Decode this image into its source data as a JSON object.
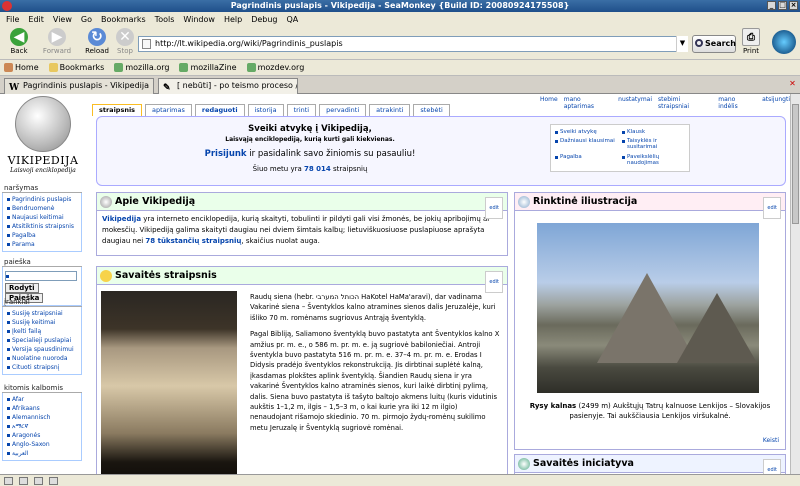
{
  "window": {
    "title": "Pagrindinis puslapis - Vikipedija - SeaMonkey {Build ID: 20080924175508}"
  },
  "menu": [
    "File",
    "Edit",
    "View",
    "Go",
    "Bookmarks",
    "Tools",
    "Window",
    "Help",
    "Debug",
    "QA"
  ],
  "nav": {
    "back": "Back",
    "forward": "Forward",
    "reload": "Reload",
    "stop": "Stop",
    "print": "Print",
    "search": "Search"
  },
  "url": "http://lt.wikipedia.org/wiki/Pagrindinis_puslapis",
  "bookmarks": [
    "Home",
    "Bookmarks",
    "mozilla.org",
    "mozillaZine",
    "mozdev.org"
  ],
  "tabs": [
    {
      "label": "Pagrindinis puslapis - Vikipedija",
      "fav": "W"
    },
    {
      "label": "[ nebūti] - po teismo proceso / K...",
      "fav": "✎"
    }
  ],
  "wiki": {
    "logo_name": "VIKIPEDIJA",
    "logo_sub": "Laisvoji enciklopedija",
    "page_tabs": [
      "straipsnis",
      "aptarimas",
      "redaguoti",
      "istorija",
      "trinti",
      "pervadinti",
      "atrakinti",
      "stebėti"
    ],
    "user_tools": [
      "Home",
      "mano aptarimas",
      "nustatymai",
      "stebimi straipsniai",
      "mano indėlis",
      "atsijungti"
    ],
    "nav_heading": "naršymas",
    "nav_items": [
      "Pagrindinis puslapis",
      "Bendruomenė",
      "Naujausi keitimai",
      "Atsitiktinis straipsnis",
      "Pagalba",
      "Parama"
    ],
    "search_heading": "paieška",
    "search_go": "Rodyti",
    "search_btn": "Paieška",
    "tools_heading": "įrankiai",
    "tools_items": [
      "Susiję straipsniai",
      "Susiję keitimai",
      "Įkelti failą",
      "Specialieji puslapiai",
      "Versija spausdinimui",
      "Nuolatine nuoroda",
      "Cituoti straipsnį"
    ],
    "lang_heading": "kitomis kalbomis",
    "lang_items": [
      "Afar",
      "Afrikaans",
      "Alemannisch",
      "አማርኛ",
      "Aragonés",
      "Anglo-Saxon",
      "العربية"
    ],
    "welcome_title": "Sveiki atvykę į Vikipediją,",
    "welcome_sub": "Laisvąją enciklopediją, kurią kurti gali kiekvienas.",
    "join_link": "Prisijunk",
    "join_rest": " ir pasidalink savo žiniomis su pasauliu!",
    "count_pre": "Šiuo metu yra ",
    "count_num": "78 014",
    "count_post": " straipsnių",
    "quick_links": [
      "Sveiki atvykę",
      "Klausk",
      "Dažniausi klausimai",
      "Taisyklės ir susitarimai",
      "Pagalba",
      "Paveikslėlių naudojimas"
    ],
    "about_title": "Apie Vikipediją",
    "about_text_link": "Vikipedija",
    "about_text": " yra interneto enciklopedija, kurią skaityti, tobulinti ir pildyti gali visi žmonės, be jokių apribojimų ar mokesčių. Vikipediją galima skaityti daugiau nei dviem šimtais kalbų; lietuviškuosiuose puslapiuose aprašyta daugiau nei ",
    "about_count": "78 tūkstančių straipsnių",
    "about_end": ", skaičius nuolat auga.",
    "weekly_title": "Savaitės straipsnis",
    "weekly_p1": "Raudų siena (hebr. הכותל המערבי HaKotel HaMa'aravi), dar vadinama Vakarinė siena – Šventyklos kalno atramines sienos dalis Jeruzalėje, kuri išliko 70 m. romėnams sugriovus Antrąją šventyklą.",
    "weekly_p2": "Pagal Bibliją, Saliamono šventyklą buvo pastatyta ant Šventyklos kalno X amžius pr. m. e., o 586 m. pr. m. e. ją sugriovė babiloniečiai. Antroji šventykla buvo pastatyta 516 m. pr. m. e. 37–4 m. pr. m. e. Erodas I Didysis pradėjo šventyklos rekonstrukciją. Jis dirbtinai suplėtė kalną, įkasdamas plokštes aplink šventyklą. Šiandien Raudų siena ir yra vakarinė Šventyklos kalno atraminės sienos, kuri laikė dirbtinį pylimą, dalis. Siena buvo pastatyta iš tašyto baltojo akmens luitų (kuris vidutinis aukštis 1–1,2 m, ilgis – 1,5–3 m, o kai kurie yra iki 12 m ilgio) nenaudojant rišamojo skiedinio. 70 m. pirmojo žydų-romėnų sukilimo metu Jeruzalę ir Šventyklą sugriovė romėnai.",
    "featured_title": "Rinktinė iliustracija",
    "featured_caption_bold": "Rysy kalnas",
    "featured_caption": " (2499 m) Aukštųjų Tatrų kalnuose Lenkijos – Slovakijos pasienyje. Tai aukščiausia Lenkijos viršukalnė.",
    "featured_more": "Keisti",
    "initiative_title": "Savaitės iniciatyva",
    "edit_label": "edit"
  }
}
